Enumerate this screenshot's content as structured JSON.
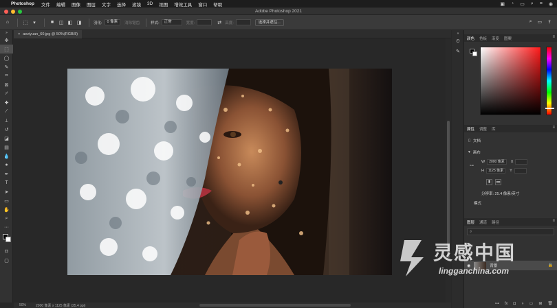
{
  "menubar": {
    "app_name": "Photoshop",
    "items": [
      "文件",
      "编辑",
      "图像",
      "图层",
      "文字",
      "选择",
      "滤镜",
      "3D",
      "视图",
      "增效工具",
      "窗口",
      "帮助"
    ]
  },
  "window": {
    "title": "Adobe Photoshop 2021"
  },
  "options": {
    "feather_label": "羽化:",
    "feather_value": "0 像素",
    "antialias_label": "消除锯齿",
    "style_label": "样式:",
    "style_value": "正常",
    "width_label": "宽度:",
    "height_label": "高度:",
    "select_mask_button": "选择并遮住..."
  },
  "document": {
    "tab_title": "aeziyuan_60.jpg @ 50%(RGB/8)",
    "tab_close": "×"
  },
  "status": {
    "zoom": "50%",
    "size": "2000 像素 x 1125 像素 (25.4 ppi)"
  },
  "color_panel": {
    "tabs": [
      "颜色",
      "色板",
      "渐变",
      "图案"
    ]
  },
  "properties_panel": {
    "tabs": [
      "属性",
      "调整",
      "库"
    ],
    "doc_label": "文档",
    "canvas_label": "画布",
    "w_label": "W",
    "w_value": "2000 像素",
    "x_label": "X",
    "h_label": "H",
    "h_value": "1125 像素",
    "y_label": "Y",
    "resolution": "分辨率: 25.4 像素/英寸",
    "mode_label": "模式"
  },
  "layers_panel": {
    "tabs": [
      "图层",
      "通道",
      "路径"
    ],
    "layer_name": "背景"
  },
  "watermark": {
    "cn": "灵感中国",
    "en": "lingganchina.com"
  }
}
